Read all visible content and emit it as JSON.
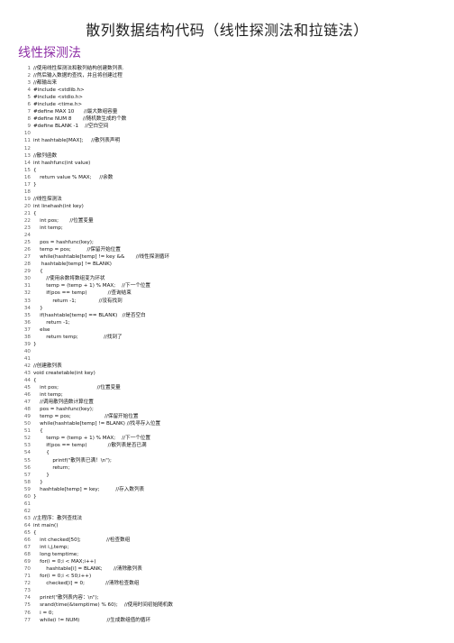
{
  "title": "散列数据结构代码（线性探测法和拉链法）",
  "section": "线性探测法",
  "lines": [
    "//使用线性探测法和散列结构创建数列表.",
    "//然后输入数据的查找，并且将创建过程",
    "//都输出来",
    "#include <stdlib.h>",
    "#include <stdio.h>",
    "#include <time.h>",
    "#define MAX 10      //最大数组容量",
    "#define NUM 8       //随机数生成的个数",
    "#define BLANK -1    //空白空间",
    "",
    "int hashtable[MAX];     //散列表声明",
    "",
    "//散列函数",
    "int hashfunc(int value)",
    "{",
    "    return value % MAX;     //余数",
    "}",
    "",
    "//线性探测法",
    "int linehash(int key)",
    "{",
    "    int pos;       //位置变量",
    "    int temp;",
    "",
    "    pos = hashfunc(key);",
    "    temp = pos;          //保留开始位置",
    "    while(hashtable[temp] != key &&       //线性探测循环",
    "     hashtable[temp] != BLANK)",
    "    {",
    "        //使用余数将数组变为环状",
    "        temp = (temp + 1) % MAX;    //下一个位置",
    "        if(pos == temp)             //查询结束",
    "            return -1;              //没有找到",
    "    }",
    "    if(hashtable[temp] == BLANK)   //是否空白",
    "        return -1;",
    "    else",
    "        return temp;                //找到了",
    "}",
    "",
    "",
    "//创建散列表",
    "void createtable(int key)",
    "{",
    "    int pos;                        //位置变量",
    "    int temp;",
    "    //调用散列函数计算位置",
    "    pos = hashfunc(key);",
    "    temp = pos;                     //保留开始位置",
    "    while(hashtable[temp] != BLANK) //找寻存入位置",
    "    {",
    "        temp = (temp + 1) % MAX;    //下一个位置",
    "        if(pos == temp)             //散列表是否已满",
    "        {",
    "            printf(\"散列表已满！\\n\");",
    "            return;",
    "        }",
    "    }",
    "    hashtable[temp] = key;          //存入数列表",
    "}",
    "",
    "",
    "//主程序：散列查找法",
    "int main()",
    "{",
    "    int checked[50];                //检查数组",
    "    int i,j,temp;",
    "    long temptime;",
    "    for(i = 0;i < MAX;i++)",
    "        hashtable[i] = BLANK;       //清除散列表",
    "    for(i = 0;i < 50;i++)",
    "        checked[i] = 0;             //清除检查数组",
    "",
    "    printf(\"散列表内容：\\n\");",
    "    srand(time(&temptime) % 60);    //使用时间初始随机数",
    "    i = 0;",
    "    while(i != NUM)                 //生成数组值的循环"
  ]
}
